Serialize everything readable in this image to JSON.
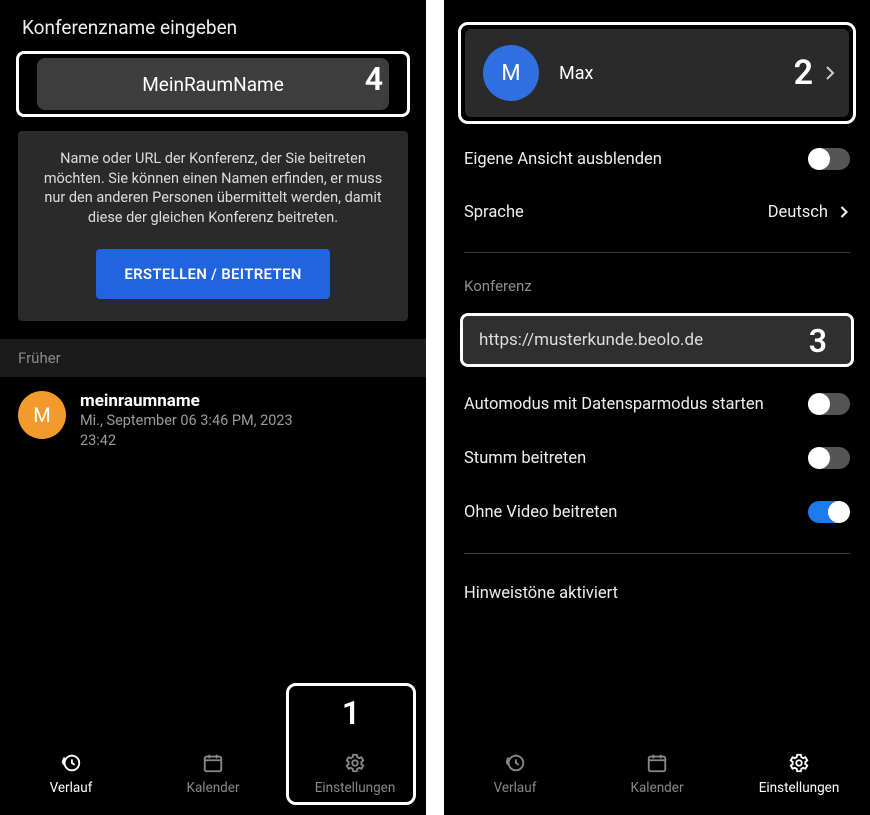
{
  "left": {
    "header": "Konferenzname eingeben",
    "room_input": "MeinRaumName",
    "input_callout": "4",
    "info_text": "Name oder URL der Konferenz, der Sie beitreten möchten. Sie können einen Namen erfinden, er muss nur den anderen Personen übermittelt werden, damit diese der gleichen Konferenz beitreten.",
    "create_btn": "ERSTELLEN / BEITRETEN",
    "earlier_label": "Früher",
    "history": {
      "avatar_letter": "M",
      "name": "meinraumname",
      "date": "Mi., September 06 3:46 PM, 2023",
      "duration": "23:42"
    },
    "nav_callout": "1"
  },
  "right": {
    "profile": {
      "avatar_letter": "M",
      "name": "Max",
      "callout": "2"
    },
    "hide_self": "Eigene Ansicht ausblenden",
    "language_label": "Sprache",
    "language_value": "Deutsch",
    "section_conf": "Konferenz",
    "url": "https://musterkunde.beolo.de",
    "url_callout": "3",
    "automode": "Automodus mit Datensparmodus starten",
    "mute": "Stumm beitreten",
    "novideo": "Ohne Video beitreten",
    "tones": "Hinweistöne aktiviert"
  },
  "nav": {
    "history": "Verlauf",
    "calendar": "Kalender",
    "settings": "Einstellungen"
  }
}
